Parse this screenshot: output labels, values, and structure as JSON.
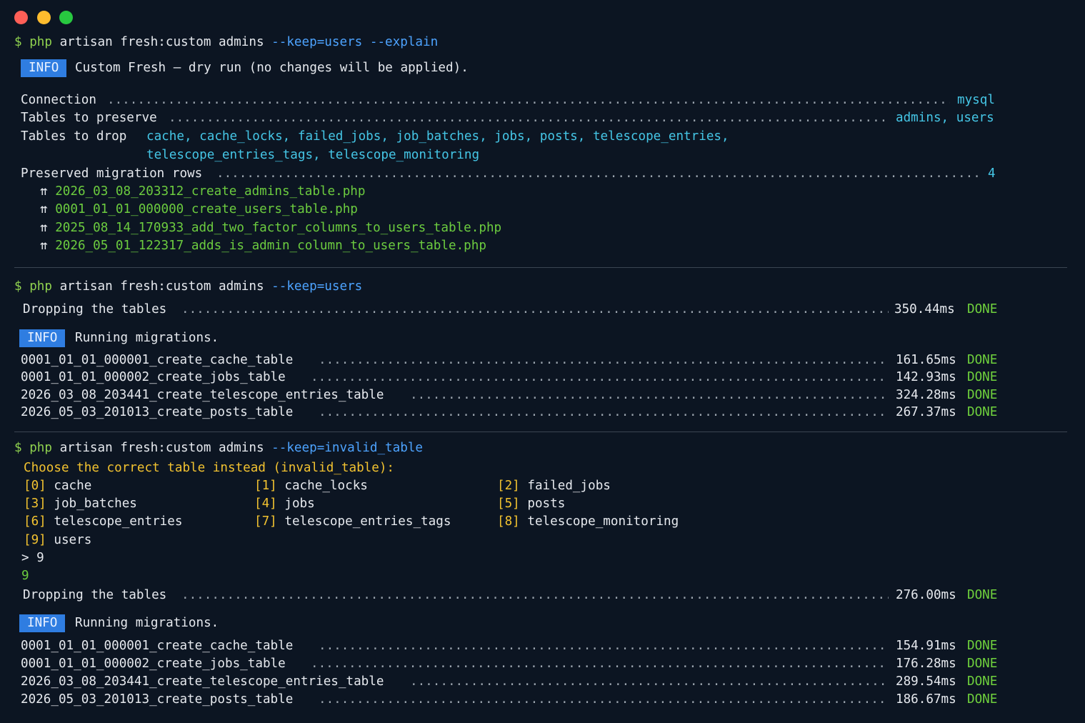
{
  "window": {
    "buttons": [
      "close",
      "minimize",
      "maximize"
    ]
  },
  "colors": {
    "background": "#0c1522",
    "prompt": "#8fd14f",
    "option": "#4da3ff",
    "value": "#45c6e6",
    "badge": "#2f7de1",
    "done": "#6fd13d",
    "warning": "#f2c230"
  },
  "block1": {
    "prompt": "$",
    "php": "php",
    "cmd": "artisan fresh:custom admins",
    "opts": "--keep=users --explain",
    "info_badge": "INFO",
    "info_text": "Custom Fresh — dry run (no changes will be applied).",
    "connection_label": "Connection",
    "connection_value": "mysql",
    "preserve_label": "Tables to preserve",
    "preserve_value": "admins, users",
    "drop_label": "Tables to drop",
    "drop_line1": "cache, cache_locks, failed_jobs, job_batches, jobs, posts, telescope_entries,",
    "drop_line2": "telescope_entries_tags, telescope_monitoring",
    "rows_label": "Preserved migration rows",
    "rows_value": "4",
    "arrow": "⇈",
    "migrations": [
      "2026_03_08_203312_create_admins_table.php",
      "0001_01_01_000000_create_users_table.php",
      "2025_08_14_170933_add_two_factor_columns_to_users_table.php",
      "2026_05_01_122317_adds_is_admin_column_to_users_table.php"
    ]
  },
  "block2": {
    "prompt": "$",
    "php": "php",
    "cmd": "artisan fresh:custom admins",
    "opts": "--keep=users",
    "dropping_label": "Dropping the tables",
    "dropping_time": "350.44ms",
    "done": "DONE",
    "info_badge": "INFO",
    "info_text": "Running migrations.",
    "rows": [
      {
        "name": "0001_01_01_000001_create_cache_table",
        "time": "161.65ms",
        "status": "DONE"
      },
      {
        "name": "0001_01_01_000002_create_jobs_table",
        "time": "142.93ms",
        "status": "DONE"
      },
      {
        "name": "2026_03_08_203441_create_telescope_entries_table",
        "time": "324.28ms",
        "status": "DONE"
      },
      {
        "name": "2026_05_03_201013_create_posts_table",
        "time": "267.37ms",
        "status": "DONE"
      }
    ]
  },
  "block3": {
    "prompt": "$",
    "php": "php",
    "cmd": "artisan fresh:custom admins",
    "opts": "--keep=invalid_table",
    "question": "Choose the correct table instead (invalid_table):",
    "choices": [
      {
        "key": "[0]",
        "label": "cache"
      },
      {
        "key": "[1]",
        "label": "cache_locks"
      },
      {
        "key": "[2]",
        "label": "failed_jobs"
      },
      {
        "key": "[3]",
        "label": "job_batches"
      },
      {
        "key": "[4]",
        "label": "jobs"
      },
      {
        "key": "[5]",
        "label": "posts"
      },
      {
        "key": "[6]",
        "label": "telescope_entries"
      },
      {
        "key": "[7]",
        "label": "telescope_entries_tags"
      },
      {
        "key": "[8]",
        "label": "telescope_monitoring"
      },
      {
        "key": "[9]",
        "label": "users"
      }
    ],
    "input_prompt": "> 9",
    "answer": "9",
    "dropping_label": "Dropping the tables",
    "dropping_time": "276.00ms",
    "done": "DONE",
    "info_badge": "INFO",
    "info_text": "Running migrations.",
    "rows": [
      {
        "name": "0001_01_01_000001_create_cache_table",
        "time": "154.91ms",
        "status": "DONE"
      },
      {
        "name": "0001_01_01_000002_create_jobs_table",
        "time": "176.28ms",
        "status": "DONE"
      },
      {
        "name": "2026_03_08_203441_create_telescope_entries_table",
        "time": "289.54ms",
        "status": "DONE"
      },
      {
        "name": "2026_05_03_201013_create_posts_table",
        "time": "186.67ms",
        "status": "DONE"
      }
    ]
  }
}
